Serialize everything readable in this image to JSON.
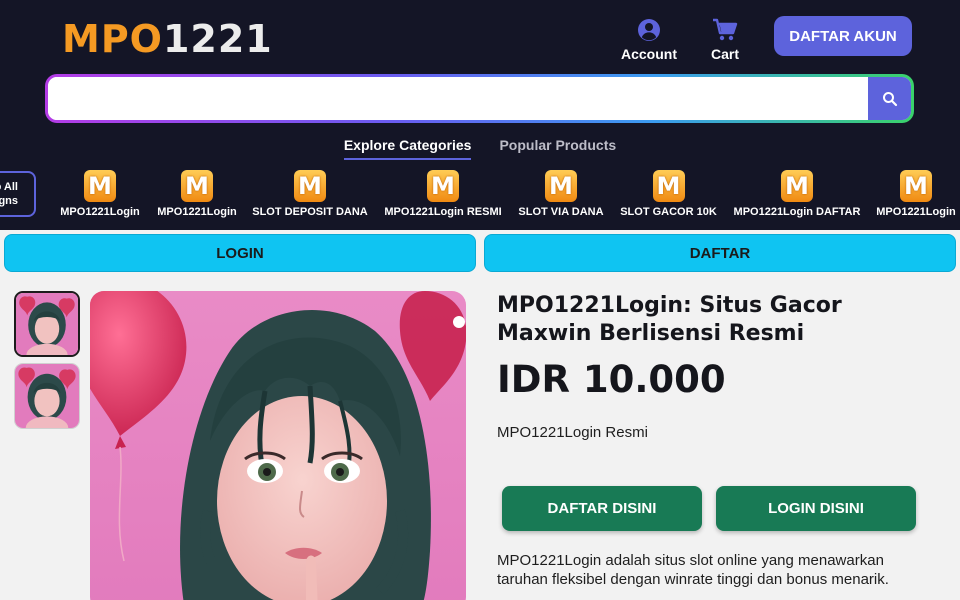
{
  "header": {
    "logo_part1": "MPO",
    "logo_part2": "1221",
    "account_label": "Account",
    "cart_label": "Cart",
    "register_button": "DAFTAR AKUN"
  },
  "search": {
    "value": "",
    "placeholder": ""
  },
  "tabs": [
    {
      "label": "Explore Categories",
      "active": true
    },
    {
      "label": "Popular Products",
      "active": false
    }
  ],
  "shop_all": {
    "line1": "o All",
    "line2": "gns"
  },
  "categories": [
    {
      "icon": "M",
      "label": "MPO1221Login"
    },
    {
      "icon": "M",
      "label": "MPO1221Login"
    },
    {
      "icon": "M",
      "label": "SLOT DEPOSIT DANA"
    },
    {
      "icon": "M",
      "label": "MPO1221Login RESMI"
    },
    {
      "icon": "M",
      "label": "SLOT VIA DANA"
    },
    {
      "icon": "M",
      "label": "SLOT GACOR 10K"
    },
    {
      "icon": "M",
      "label": "MPO1221Login DAFTAR"
    },
    {
      "icon": "M",
      "label": "MPO1221Login"
    }
  ],
  "action_bar": {
    "login": "LOGIN",
    "daftar": "DAFTAR"
  },
  "product": {
    "title": "MPO1221Login: Situs Gacor Maxwin Berlisensi Resmi",
    "price": "IDR 10.000",
    "subtitle": "MPO1221Login Resmi",
    "cta_register": "DAFTAR DISINI",
    "cta_login": "LOGIN DISINI",
    "description": "MPO1221Login adalah situs slot online yang menawarkan taruhan fleksibel dengan winrate tinggi dan bonus menarik."
  },
  "colors": {
    "header_bg": "#141526",
    "accent": "#5d63dc",
    "logo_orange": "#f59a23",
    "cyan_bar": "#0fc4f2",
    "cta_green": "#187a55"
  },
  "icons": {
    "account": "account-circle-icon",
    "cart": "cart-icon",
    "search": "search-icon",
    "category": "mpo-logo-icon"
  }
}
